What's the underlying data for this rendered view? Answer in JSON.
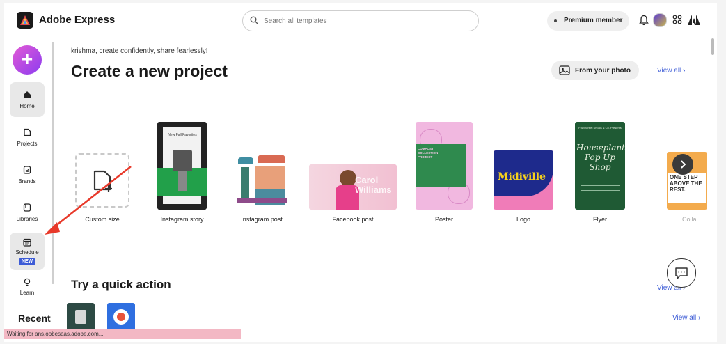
{
  "app": {
    "brand": "Adobe Express"
  },
  "search": {
    "placeholder": "Search all templates"
  },
  "header": {
    "premium_label": "Premium member"
  },
  "sidebar": {
    "create_label": "+",
    "items": [
      {
        "label": "Home"
      },
      {
        "label": "Projects"
      },
      {
        "label": "Brands"
      },
      {
        "label": "Libraries"
      },
      {
        "label": "Schedule",
        "badge": "NEW"
      },
      {
        "label": "Learn"
      }
    ]
  },
  "main": {
    "greeting": "krishma, create confidently, share fearlessly!",
    "title": "Create a new project",
    "from_photo_label": "From your photo",
    "view_all": "View all",
    "cards": [
      {
        "label": "Custom size"
      },
      {
        "label": "Instagram story"
      },
      {
        "label": "Instagram post"
      },
      {
        "label": "Facebook post"
      },
      {
        "label": "Poster"
      },
      {
        "label": "Logo"
      },
      {
        "label": "Flyer"
      },
      {
        "label": "Colla"
      }
    ],
    "thumb_text": {
      "story_top": "New Fall Favorites",
      "facebook": "Carol Williams",
      "poster": "COMPOST COLLECTION PROJECT",
      "logo": "Midiville",
      "flyer_small": "Fowl Street Shoals & Co. Presents",
      "flyer_title": "Houseplant Pop Up Shop",
      "collage": "ONE STEP ABOVE THE REST."
    },
    "quick_action_title": "Try a quick action",
    "quick_view_all": "View all"
  },
  "recent": {
    "title": "Recent",
    "view_all": "View all"
  },
  "status": {
    "text": "Waiting for ans.oobesaas.adobe.com..."
  },
  "colors": {
    "accent": "#3d5cd6",
    "annotation": "#e8392a"
  }
}
